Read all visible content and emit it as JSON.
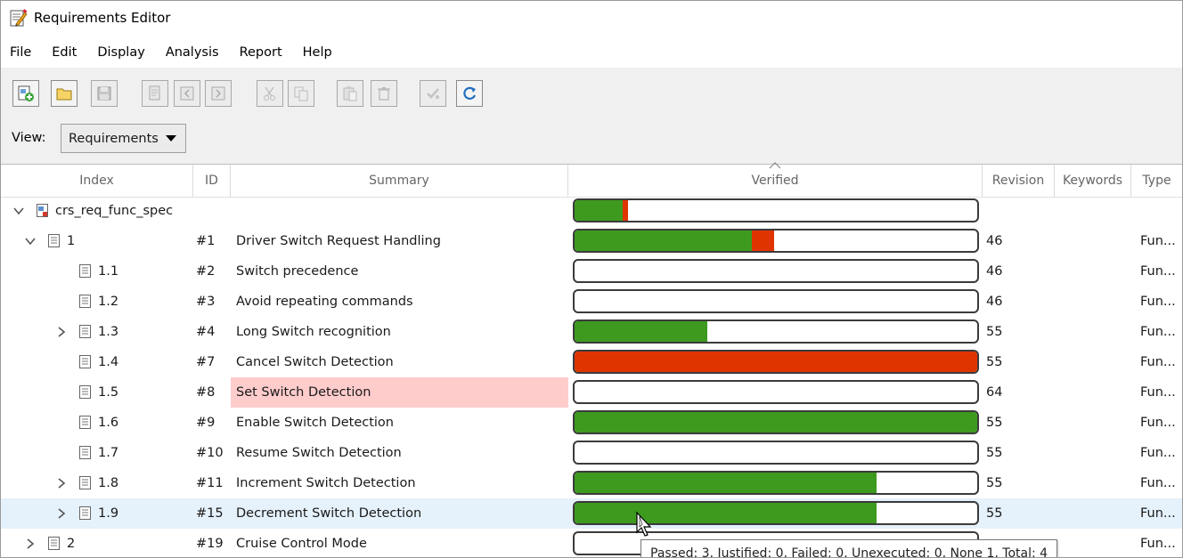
{
  "window": {
    "title": "Requirements Editor"
  },
  "menu": [
    "File",
    "Edit",
    "Display",
    "Analysis",
    "Report",
    "Help"
  ],
  "toolbar": {
    "buttons": [
      {
        "icon": "new-requirement-set-icon",
        "enabled": true
      },
      {
        "icon": "open-folder-icon",
        "enabled": true
      },
      {
        "icon": "save-icon",
        "enabled": false
      },
      {
        "icon": "add-requirement-icon",
        "enabled": false
      },
      {
        "icon": "demote-icon",
        "enabled": false
      },
      {
        "icon": "promote-icon",
        "enabled": false
      },
      {
        "icon": "cut-icon",
        "enabled": false
      },
      {
        "icon": "copy-icon",
        "enabled": false
      },
      {
        "icon": "paste-icon",
        "enabled": false
      },
      {
        "icon": "delete-icon",
        "enabled": false
      },
      {
        "icon": "verify-icon",
        "enabled": false
      },
      {
        "icon": "refresh-icon",
        "enabled": true
      }
    ],
    "view_label": "View:",
    "view_value": "Requirements"
  },
  "columns": {
    "index": "Index",
    "id": "ID",
    "summary": "Summary",
    "verified": "Verified",
    "revision": "Revision",
    "keywords": "Keywords",
    "type": "Type"
  },
  "colors": {
    "passed": "#3d9a1f",
    "failed": "#e03400",
    "highlight": "#ffcccc",
    "selected": "#e5f1fb"
  },
  "rows": [
    {
      "level": 0,
      "expander": "down",
      "icon": "requirement-set-icon",
      "index": "crs_req_func_spec",
      "id": "",
      "summary": "",
      "passed": 0.12,
      "failed": 0.013,
      "revision": "",
      "type": ""
    },
    {
      "level": 1,
      "expander": "down",
      "icon": "requirement-icon",
      "index": "1",
      "id": "#1",
      "summary": "Driver Switch Request Handling",
      "passed": 0.44,
      "failed": 0.055,
      "revision": "46",
      "type": "Fun..."
    },
    {
      "level": 2,
      "expander": "",
      "icon": "requirement-icon",
      "index": "1.1",
      "id": "#2",
      "summary": "Switch precedence",
      "passed": 0,
      "failed": 0,
      "revision": "46",
      "type": "Fun..."
    },
    {
      "level": 2,
      "expander": "",
      "icon": "requirement-icon",
      "index": "1.2",
      "id": "#3",
      "summary": "Avoid repeating commands",
      "passed": 0,
      "failed": 0,
      "revision": "46",
      "type": "Fun..."
    },
    {
      "level": 2,
      "expander": "right",
      "icon": "requirement-icon",
      "index": "1.3",
      "id": "#4",
      "summary": "Long Switch recognition",
      "passed": 0.33,
      "failed": 0,
      "revision": "55",
      "type": "Fun..."
    },
    {
      "level": 2,
      "expander": "",
      "icon": "requirement-icon",
      "index": "1.4",
      "id": "#7",
      "summary": "Cancel Switch Detection",
      "passed": 0,
      "failed": 1,
      "revision": "55",
      "type": "Fun..."
    },
    {
      "level": 2,
      "expander": "",
      "icon": "requirement-icon",
      "index": "1.5",
      "id": "#8",
      "summary": "Set Switch Detection",
      "passed": 0,
      "failed": 0,
      "revision": "64",
      "type": "Fun...",
      "highlight": true
    },
    {
      "level": 2,
      "expander": "",
      "icon": "requirement-icon",
      "index": "1.6",
      "id": "#9",
      "summary": "Enable Switch Detection",
      "passed": 1,
      "failed": 0,
      "revision": "55",
      "type": "Fun..."
    },
    {
      "level": 2,
      "expander": "",
      "icon": "requirement-icon",
      "index": "1.7",
      "id": "#10",
      "summary": "Resume Switch Detection",
      "passed": 0,
      "failed": 0,
      "revision": "55",
      "type": "Fun..."
    },
    {
      "level": 2,
      "expander": "right",
      "icon": "requirement-icon",
      "index": "1.8",
      "id": "#11",
      "summary": "Increment Switch Detection",
      "passed": 0.75,
      "failed": 0,
      "revision": "55",
      "type": "Fun..."
    },
    {
      "level": 2,
      "expander": "right",
      "icon": "requirement-icon",
      "index": "1.9",
      "id": "#15",
      "summary": "Decrement Switch Detection",
      "passed": 0.75,
      "failed": 0,
      "revision": "55",
      "type": "Fun...",
      "selected": true
    },
    {
      "level": 1,
      "expander": "right",
      "icon": "requirement-icon",
      "index": "2",
      "id": "#19",
      "summary": "Cruise Control Mode",
      "passed": 0,
      "failed": 0,
      "revision": "",
      "type": "Fun..."
    }
  ],
  "tooltip": "Passed: 3, Justified: 0, Failed: 0, Unexecuted: 0, None 1, Total: 4"
}
